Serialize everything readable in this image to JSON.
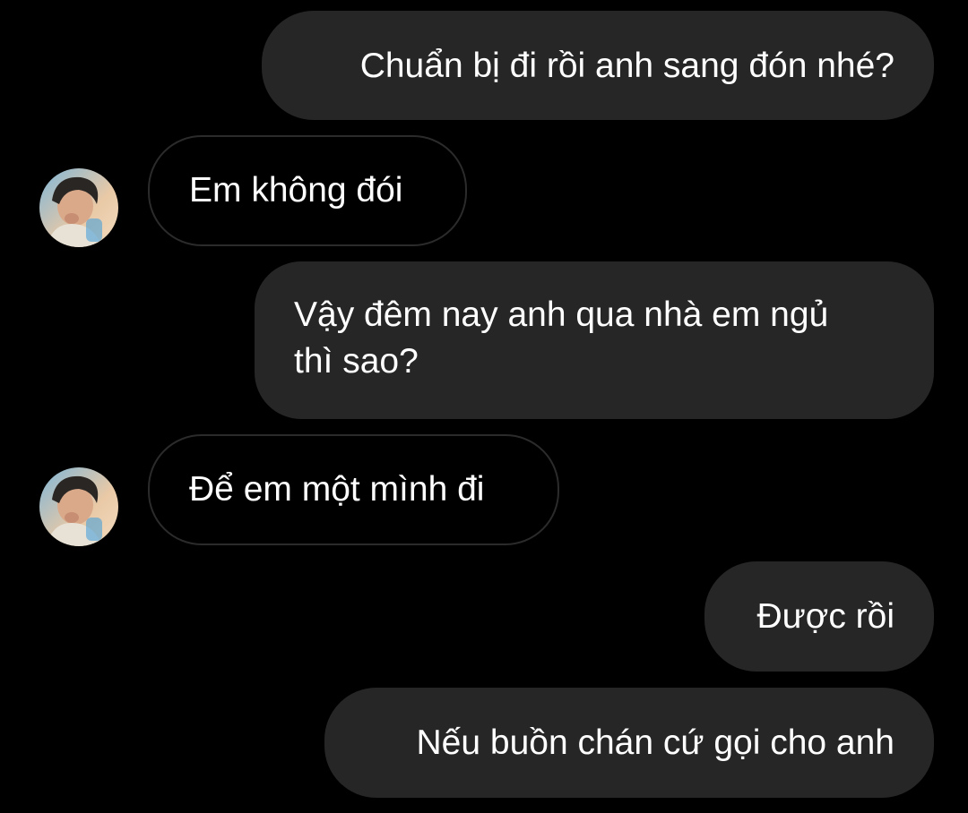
{
  "thread": {
    "messages": [
      {
        "sender": "me",
        "text": "Chuẩn bị đi rồi anh sang đón nhé?"
      },
      {
        "sender": "contact",
        "text": "Em không đói"
      },
      {
        "sender": "me",
        "lines": [
          "Vậy đêm nay anh qua nhà em ngủ",
          "thì sao?"
        ]
      },
      {
        "sender": "contact",
        "text": "Để em một mình đi"
      },
      {
        "sender": "me",
        "text": "Được rồi"
      },
      {
        "sender": "me",
        "text": "Nếu buồn chán cứ gọi cho anh"
      }
    ]
  },
  "colors": {
    "background": "#000000",
    "outgoing_bubble": "#262626",
    "incoming_border": "#2b2b2b",
    "text": "#ffffff"
  },
  "icons": {
    "contact_avatar": "contact-avatar-photo"
  }
}
